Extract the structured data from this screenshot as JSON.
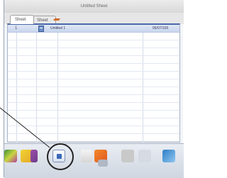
{
  "window": {
    "title": "Untitled Sheet"
  },
  "tabs": [
    {
      "label": "Sheet 1"
    },
    {
      "label": "Sheet 2"
    }
  ],
  "sheet": {
    "selected_row": {
      "name": "Untitled 1",
      "date": "05/07/100"
    }
  },
  "toolbar": {
    "icons": [
      "photo-icon",
      "folder-icon",
      "purple-book-icon",
      "document-icon",
      "blank-page-icon",
      "orange-shape-icon",
      "grey-box-icon",
      "chart-icon",
      "blue-window-icon"
    ]
  },
  "colors": {
    "selection": "#c9d6ee",
    "header_accent": "#4a67a8",
    "callout": "#222222"
  }
}
